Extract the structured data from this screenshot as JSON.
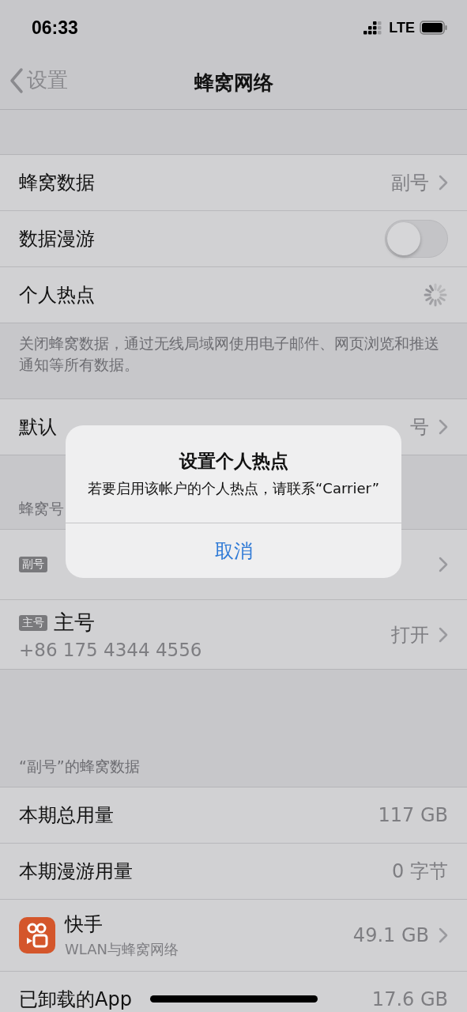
{
  "status_bar": {
    "time": "06:33",
    "network": "LTE"
  },
  "nav": {
    "back": "设置",
    "title": "蜂窝网络"
  },
  "sections": [
    {
      "rows": [
        {
          "kind": "value",
          "label": "蜂窝数据",
          "value": "副号",
          "chevron": true
        },
        {
          "kind": "toggle",
          "label": "数据漫游",
          "on": false
        },
        {
          "kind": "spinner",
          "label": "个人热点"
        }
      ],
      "footer": "关闭蜂窝数据，通过无线局域网使用电子邮件、网页浏览和推送通知等所有数据。"
    },
    {
      "rows": [
        {
          "kind": "value",
          "label": "默认",
          "value": "号",
          "chevron": true
        }
      ]
    },
    {
      "header": "蜂窝号",
      "rows": [
        {
          "kind": "sim",
          "badge": "副号",
          "chevron": true
        },
        {
          "kind": "sim",
          "badge": "主号",
          "name": "主号",
          "number": "+86 175 4344 4556",
          "value": "打开",
          "chevron": true
        }
      ]
    },
    {
      "header": "“副号”的蜂窝数据",
      "rows": [
        {
          "kind": "value",
          "label": "本期总用量",
          "value": "117 GB",
          "chevron": false
        },
        {
          "kind": "value",
          "label": "本期漫游用量",
          "value": "0 字节",
          "chevron": false
        },
        {
          "kind": "app",
          "label": "快手",
          "sub": "WLAN与蜂窝网络",
          "value": "49.1 GB",
          "chevron": true
        },
        {
          "kind": "value",
          "label": "已卸载的App",
          "value": "17.6 GB",
          "chevron": false
        }
      ]
    }
  ],
  "alert": {
    "title": "设置个人热点",
    "message": "若要启用该帐户的个人热点，请联系“Carrier”",
    "buttons": [
      "取消"
    ]
  }
}
